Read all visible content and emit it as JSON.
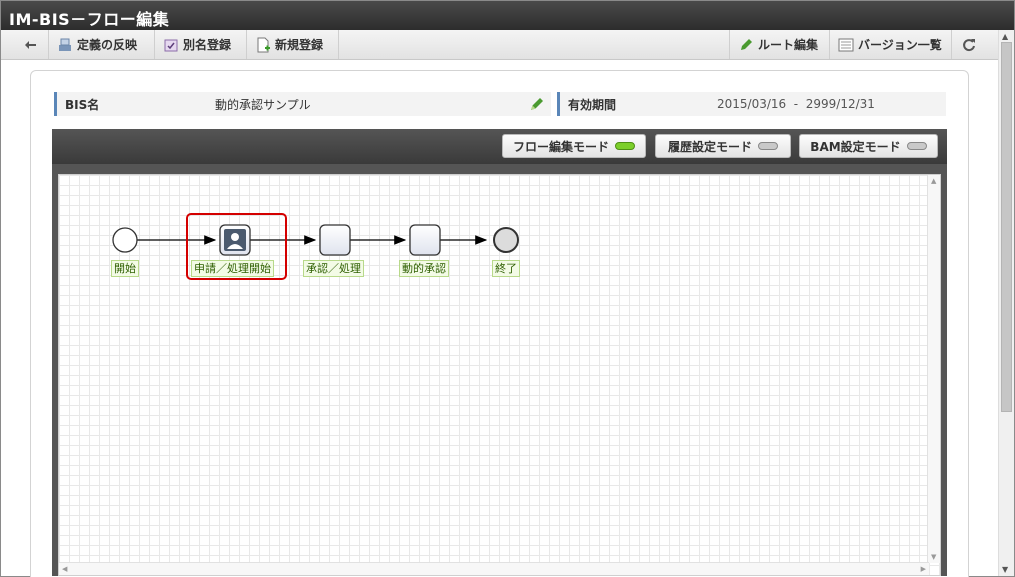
{
  "window": {
    "title": "IM-BIS－フロー編集"
  },
  "toolbar": {
    "back_icon": "arrow-left-icon",
    "apply_label": "定義の反映",
    "alias_label": "別名登録",
    "new_label": "新規登録",
    "route_edit_label": "ルート編集",
    "version_list_label": "バージョン一覧",
    "refresh_icon": "refresh-icon"
  },
  "info": {
    "bis_name_label": "BIS名",
    "bis_name_value": "動的承認サンプル",
    "period_label": "有効期間",
    "period_start": "2015/03/16",
    "period_separator": "-",
    "period_end": "2999/12/31",
    "period_text": "2015/03/16  -  2999/12/31"
  },
  "modes": [
    {
      "label": "フロー編集モード",
      "active": true
    },
    {
      "label": "履歴設定モード",
      "active": false
    },
    {
      "label": "BAM設定モード",
      "active": false
    }
  ],
  "colors": {
    "led_active": "#7ccf2a",
    "led_inactive": "#c9c9c9",
    "highlight": "#d40000",
    "accent": "#5a86b8"
  },
  "flow": {
    "nodes": [
      {
        "id": "start",
        "type": "start-event",
        "label": "開始"
      },
      {
        "id": "apply",
        "type": "user-task",
        "label": "申請／処理開始",
        "highlighted": true
      },
      {
        "id": "approve",
        "type": "task",
        "label": "承認／処理"
      },
      {
        "id": "dynamic",
        "type": "task",
        "label": "動的承認"
      },
      {
        "id": "end",
        "type": "end-event",
        "label": "終了"
      }
    ],
    "edges": [
      [
        "start",
        "apply"
      ],
      [
        "apply",
        "approve"
      ],
      [
        "approve",
        "dynamic"
      ],
      [
        "dynamic",
        "end"
      ]
    ]
  }
}
